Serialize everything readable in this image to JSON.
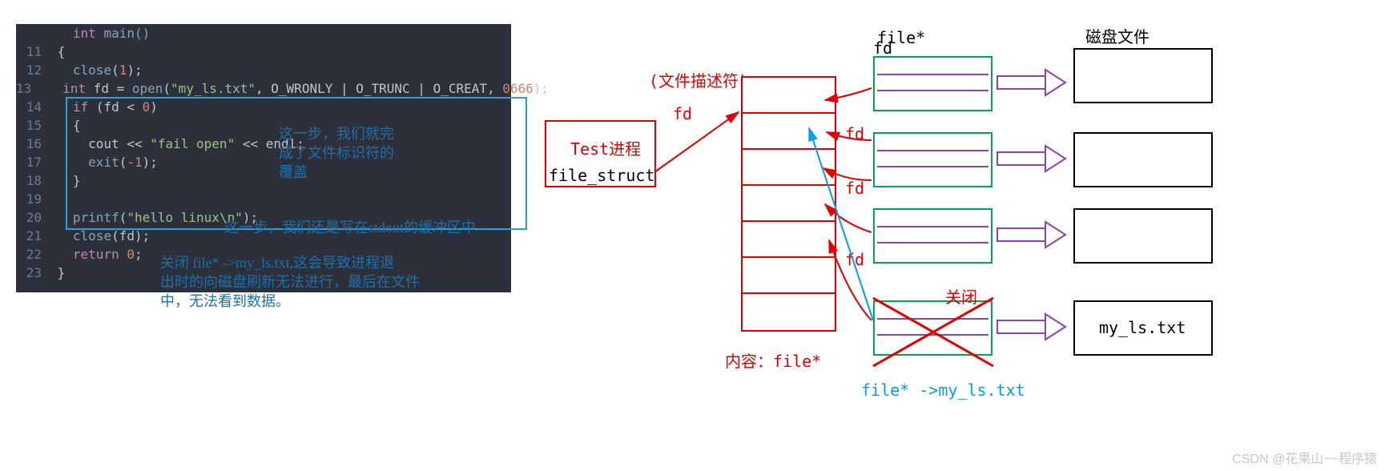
{
  "code": {
    "l10_a": "int",
    "l10_b": " main()",
    "l11": "{",
    "l12": "close",
    "l12_n": "1",
    "l13_a": "int",
    "l13_b": " fd = ",
    "l13_c": "open",
    "l13_d": "\"my_ls.txt\"",
    "l13_e": ", O_WRONLY | O_TRUNC | O_CREAT, ",
    "l13_f": "0666",
    "l14_a": "if",
    "l14_b": " (fd < ",
    "l14_c": "0",
    "l14_d": ")",
    "l15": "{",
    "l16_a": "cout << ",
    "l16_b": "\"fail open\"",
    "l16_c": " << endl;",
    "l17_a": "exit",
    "l17_b": "-1",
    "l18": "}",
    "l20_a": "printf",
    "l20_b": "\"hello linux\\n\"",
    "l21_a": "close",
    "l21_b": "(fd);",
    "l22_a": "return",
    "l22_b": "0",
    "l23": "}"
  },
  "annotations": {
    "a1_l1": "这一步，我们就完",
    "a1_l2": "成了文件标识符的",
    "a1_l3": "覆盖",
    "a2": "这一步，我们还是写在stdout的缓冲区中",
    "a3_l1": "关闭 file* ->my_ls.txt,这会导致进程退",
    "a3_l2": "出时的向磁盘刷新无法进行，最后在文件",
    "a3_l3": "中，无法看到数据。"
  },
  "diagram": {
    "fd_desc_label": "(文件描述符)",
    "fd": "fd",
    "test_proc": "Test进程",
    "file_struct": "file_struct",
    "content_label": "内容：file*",
    "file_star": "file*",
    "disk_file": "磁盘文件",
    "close_label": "关闭",
    "file_ptr_txt": "file*  ->my_ls.txt",
    "my_ls": "my_ls.txt"
  },
  "watermark": "CSDN @花果山~~程序猿"
}
